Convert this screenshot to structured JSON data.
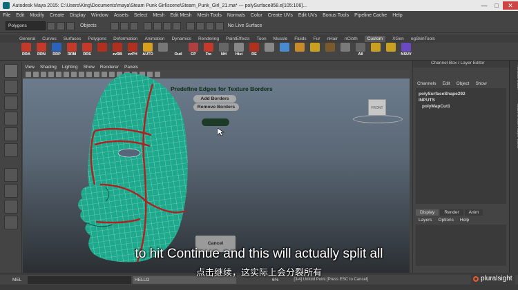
{
  "window": {
    "title": "Autodesk Maya 2015: C:\\Users\\King\\Documents\\maya\\Steam Punk Girl\\scene\\Steam_Punk_Girl_21.ma*  ---  polySurface858.e[105:106]...",
    "min": "—",
    "max": "□",
    "close": "✕"
  },
  "menubar": [
    "File",
    "Edit",
    "Modify",
    "Create",
    "Display",
    "Window",
    "Assets",
    "Select",
    "Mesh",
    "Edit Mesh",
    "Mesh Tools",
    "Normals",
    "Color",
    "Create UVs",
    "Edit UVs",
    "Bonus Tools",
    "Pipeline Cache",
    "Help"
  ],
  "statusline": {
    "mode": "Polygons",
    "objects_label": "Objects",
    "live_surface": "No Live Surface"
  },
  "shelf_tabs": [
    "General",
    "Curves",
    "Surfaces",
    "Polygons",
    "Deformation",
    "Animation",
    "Dynamics",
    "Rendering",
    "PaintEffects",
    "Toon",
    "Muscle",
    "Fluids",
    "Fur",
    "nHair",
    "nCloth",
    "Custom",
    "XGen",
    "ngSkinTools"
  ],
  "shelf_tab_active": "Custom",
  "shelf_items": [
    {
      "label": "RRA",
      "color": "#c43a2a"
    },
    {
      "label": "RRN",
      "color": "#c43a2a"
    },
    {
      "label": "RRP",
      "color": "#2c63b8"
    },
    {
      "label": "RRM",
      "color": "#c43a2a"
    },
    {
      "label": "RRS",
      "color": "#c43a2a"
    },
    {
      "label": "",
      "color": "#b03020"
    },
    {
      "label": "zvRB",
      "color": "#b03020"
    },
    {
      "label": "zvPH",
      "color": "#b03020"
    },
    {
      "label": "AUTO",
      "color": "#d9a020"
    },
    {
      "label": "",
      "color": "#777"
    },
    {
      "label": "Outl",
      "color": "#444"
    },
    {
      "label": "CP",
      "color": "#b04040"
    },
    {
      "label": "Fto",
      "color": "#c43a2a"
    },
    {
      "label": "NH",
      "color": "#666"
    },
    {
      "label": "Hist",
      "color": "#888"
    },
    {
      "label": "RE",
      "color": "#b03020"
    },
    {
      "label": "",
      "color": "#888"
    },
    {
      "label": "",
      "color": "#4a8ad0"
    },
    {
      "label": "",
      "color": "#c98a2a"
    },
    {
      "label": "",
      "color": "#c9a020"
    },
    {
      "label": "",
      "color": "#7a5a2a"
    },
    {
      "label": "",
      "color": "#7a7a7a"
    },
    {
      "label": "All",
      "color": "#666"
    },
    {
      "label": "",
      "color": "#c9a020"
    },
    {
      "label": "",
      "color": "#c9a020"
    },
    {
      "label": "NSUV",
      "color": "#6a4ac0"
    }
  ],
  "viewport": {
    "menu": [
      "View",
      "Shading",
      "Lighting",
      "Show",
      "Renderer",
      "Panels"
    ],
    "cube_label": "FRONT"
  },
  "tool_ui": {
    "title": "Predefine Edges for Texture Borders",
    "add_borders": "Add  Borders",
    "remove_borders": "Remove Borders",
    "continue": "Continue",
    "cancel": "Cancel"
  },
  "channel_box": {
    "header": "Channel Box / Layer Editor",
    "menu": [
      "Channels",
      "Edit",
      "Object",
      "Show"
    ],
    "node": "polySurfaceShape292",
    "inputs": "INPUTS",
    "input_node": "polyMapCut1"
  },
  "layer_editor": {
    "tabs": [
      "Display",
      "Render",
      "Anim"
    ],
    "menu": [
      "Layers",
      "Options",
      "Help"
    ]
  },
  "side_strip": [
    "Attribute Editor",
    "Channel Box / Layer Editor"
  ],
  "command_line": {
    "mel": "MEL",
    "result": "HELLO",
    "percent": "6%",
    "message": "[3/4] Unfold Point [Press ESC to Cancel]"
  },
  "subtitles": {
    "en": "to hit Continue and this will actually split all",
    "cn": "点击继续，这实际上会分裂所有"
  },
  "brand": "pluralsight"
}
